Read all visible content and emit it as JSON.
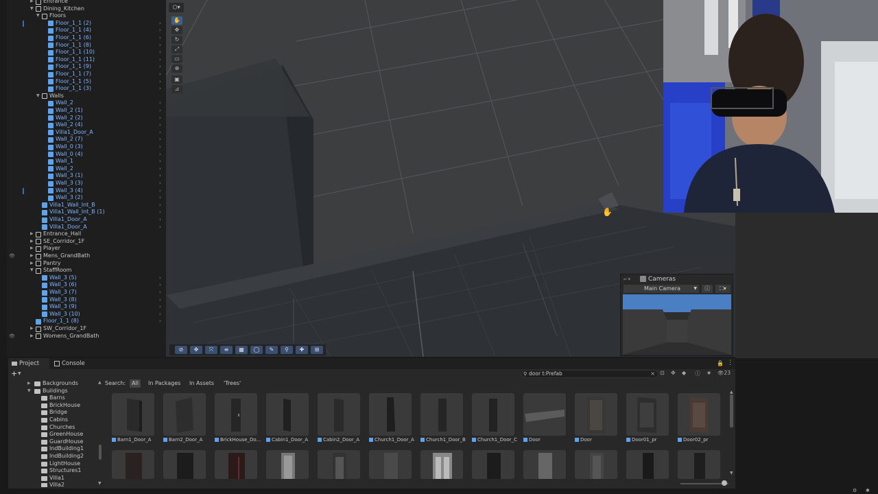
{
  "hierarchy": {
    "rows": [
      {
        "label": "Entrance",
        "indent": 1,
        "type": "go",
        "expanded": false
      },
      {
        "label": "Dining_Kitchen",
        "indent": 1,
        "type": "go",
        "expanded": true
      },
      {
        "label": "Floors",
        "indent": 2,
        "type": "go",
        "expanded": true
      },
      {
        "label": "Floor_1_1 (2)",
        "indent": 3,
        "type": "pf",
        "mark": true
      },
      {
        "label": "Floor_1_1 (4)",
        "indent": 3,
        "type": "pf"
      },
      {
        "label": "Floor_1_1 (6)",
        "indent": 3,
        "type": "pf"
      },
      {
        "label": "Floor_1_1 (8)",
        "indent": 3,
        "type": "pf"
      },
      {
        "label": "Floor_1_1 (10)",
        "indent": 3,
        "type": "pf"
      },
      {
        "label": "Floor_1_1 (11)",
        "indent": 3,
        "type": "pf"
      },
      {
        "label": "Floor_1_1 (9)",
        "indent": 3,
        "type": "pf"
      },
      {
        "label": "Floor_1_1 (7)",
        "indent": 3,
        "type": "pf"
      },
      {
        "label": "Floor_1_1 (5)",
        "indent": 3,
        "type": "pf"
      },
      {
        "label": "Floor_1_1 (3)",
        "indent": 3,
        "type": "pf"
      },
      {
        "label": "Walls",
        "indent": 2,
        "type": "go",
        "expanded": true
      },
      {
        "label": "Wall_2",
        "indent": 3,
        "type": "pf"
      },
      {
        "label": "Wall_2 (1)",
        "indent": 3,
        "type": "pf"
      },
      {
        "label": "Wall_2 (2)",
        "indent": 3,
        "type": "pf"
      },
      {
        "label": "Wall_2 (4)",
        "indent": 3,
        "type": "pf"
      },
      {
        "label": "Villa1_Door_A",
        "indent": 3,
        "type": "pf"
      },
      {
        "label": "Wall_2 (7)",
        "indent": 3,
        "type": "pf"
      },
      {
        "label": "Wall_0 (3)",
        "indent": 3,
        "type": "pf"
      },
      {
        "label": "Wall_0 (4)",
        "indent": 3,
        "type": "pf"
      },
      {
        "label": "Wall_1",
        "indent": 3,
        "type": "pf"
      },
      {
        "label": "Wall_2",
        "indent": 3,
        "type": "pf"
      },
      {
        "label": "Wall_3 (1)",
        "indent": 3,
        "type": "pf"
      },
      {
        "label": "Wall_3 (3)",
        "indent": 3,
        "type": "pf"
      },
      {
        "label": "Wall_3 (4)",
        "indent": 3,
        "type": "pf",
        "mark": true
      },
      {
        "label": "Wall_3 (2)",
        "indent": 3,
        "type": "pf"
      },
      {
        "label": "Villa1_Wall_Int_B",
        "indent": 2,
        "type": "pf"
      },
      {
        "label": "Villa1_Wall_Int_B (1)",
        "indent": 2,
        "type": "pf"
      },
      {
        "label": "Villa1_Door_A",
        "indent": 2,
        "type": "pf"
      },
      {
        "label": "Villa1_Door_A",
        "indent": 2,
        "type": "pf"
      },
      {
        "label": "Entrance_Hall",
        "indent": 1,
        "type": "go",
        "expanded": false
      },
      {
        "label": "SE_Corridor_1F",
        "indent": 1,
        "type": "go",
        "expanded": false
      },
      {
        "label": "Player",
        "indent": 1,
        "type": "go",
        "expanded": false
      },
      {
        "label": "Mens_GrandBath",
        "indent": 1,
        "type": "go",
        "expanded": false,
        "eye": true
      },
      {
        "label": "Pantry",
        "indent": 1,
        "type": "go",
        "expanded": false
      },
      {
        "label": "StaffRoom",
        "indent": 1,
        "type": "go",
        "expanded": true
      },
      {
        "label": "Wall_3 (5)",
        "indent": 2,
        "type": "pf"
      },
      {
        "label": "Wall_3 (6)",
        "indent": 2,
        "type": "pf"
      },
      {
        "label": "Wall_3 (7)",
        "indent": 2,
        "type": "pf"
      },
      {
        "label": "Wall_3 (8)",
        "indent": 2,
        "type": "pf"
      },
      {
        "label": "Wall_3 (9)",
        "indent": 2,
        "type": "pf"
      },
      {
        "label": "Wall_3 (10)",
        "indent": 2,
        "type": "pf"
      },
      {
        "label": "Floor_1_1 (8)",
        "indent": 1,
        "type": "pf"
      },
      {
        "label": "SW_Corridor_1F",
        "indent": 1,
        "type": "go",
        "expanded": false
      },
      {
        "label": "Womens_GrandBath",
        "indent": 1,
        "type": "go",
        "expanded": false,
        "eye": true
      }
    ]
  },
  "scene": {
    "tools": [
      "hand-tool-icon",
      "move-tool-icon",
      "rotate-tool-icon",
      "scale-tool-icon",
      "rect-tool-icon",
      "transform-tool-icon",
      "custom-tool-icon",
      "snap-tool-icon"
    ],
    "bottom_tools": [
      "orbit-icon",
      "move-icon",
      "scale-icon",
      "align-icon",
      "grid-icon",
      "sphere-icon",
      "paint-icon",
      "search-icon",
      "plus-icon",
      "frame-icon"
    ]
  },
  "cameras": {
    "title": "Cameras",
    "selected_camera": "Main Camera"
  },
  "project": {
    "tabs": [
      {
        "label": "Project",
        "active": true
      },
      {
        "label": "Console",
        "active": false
      }
    ],
    "add_label": "+",
    "search_value": "door t:Prefab",
    "count": "23",
    "folders": [
      {
        "label": "Backgrounds",
        "indent": 1,
        "expanded": false
      },
      {
        "label": "Buildings",
        "indent": 1,
        "expanded": true
      },
      {
        "label": "Barns",
        "indent": 2
      },
      {
        "label": "BrickHouse",
        "indent": 2
      },
      {
        "label": "Bridge",
        "indent": 2
      },
      {
        "label": "Cabins",
        "indent": 2
      },
      {
        "label": "Churches",
        "indent": 2
      },
      {
        "label": "GreenHouse",
        "indent": 2
      },
      {
        "label": "GuardHouse",
        "indent": 2
      },
      {
        "label": "IndBuilding1",
        "indent": 2
      },
      {
        "label": "IndBuilding2",
        "indent": 2
      },
      {
        "label": "LightHouse",
        "indent": 2
      },
      {
        "label": "Structures1",
        "indent": 2
      },
      {
        "label": "Villa1",
        "indent": 2
      },
      {
        "label": "Villa2",
        "indent": 2
      }
    ],
    "filter": {
      "search_label": "Search:",
      "chips": [
        {
          "label": "All",
          "selected": true
        },
        {
          "label": "In Packages",
          "selected": false
        },
        {
          "label": "In Assets",
          "selected": false
        },
        {
          "label": "'Trees'",
          "selected": false
        }
      ]
    },
    "assets_row1": [
      "Barn1_Door_A",
      "Barn2_Door_A",
      "BrickHouse_Do...",
      "Cabin1_Door_A",
      "Cabin2_Door_A",
      "Church1_Door_A",
      "Church1_Door_B",
      "Church1_Door_C",
      "Door",
      "Door",
      "Door01_pr",
      "Door02_pr"
    ],
    "assets_row2_count": 12
  }
}
